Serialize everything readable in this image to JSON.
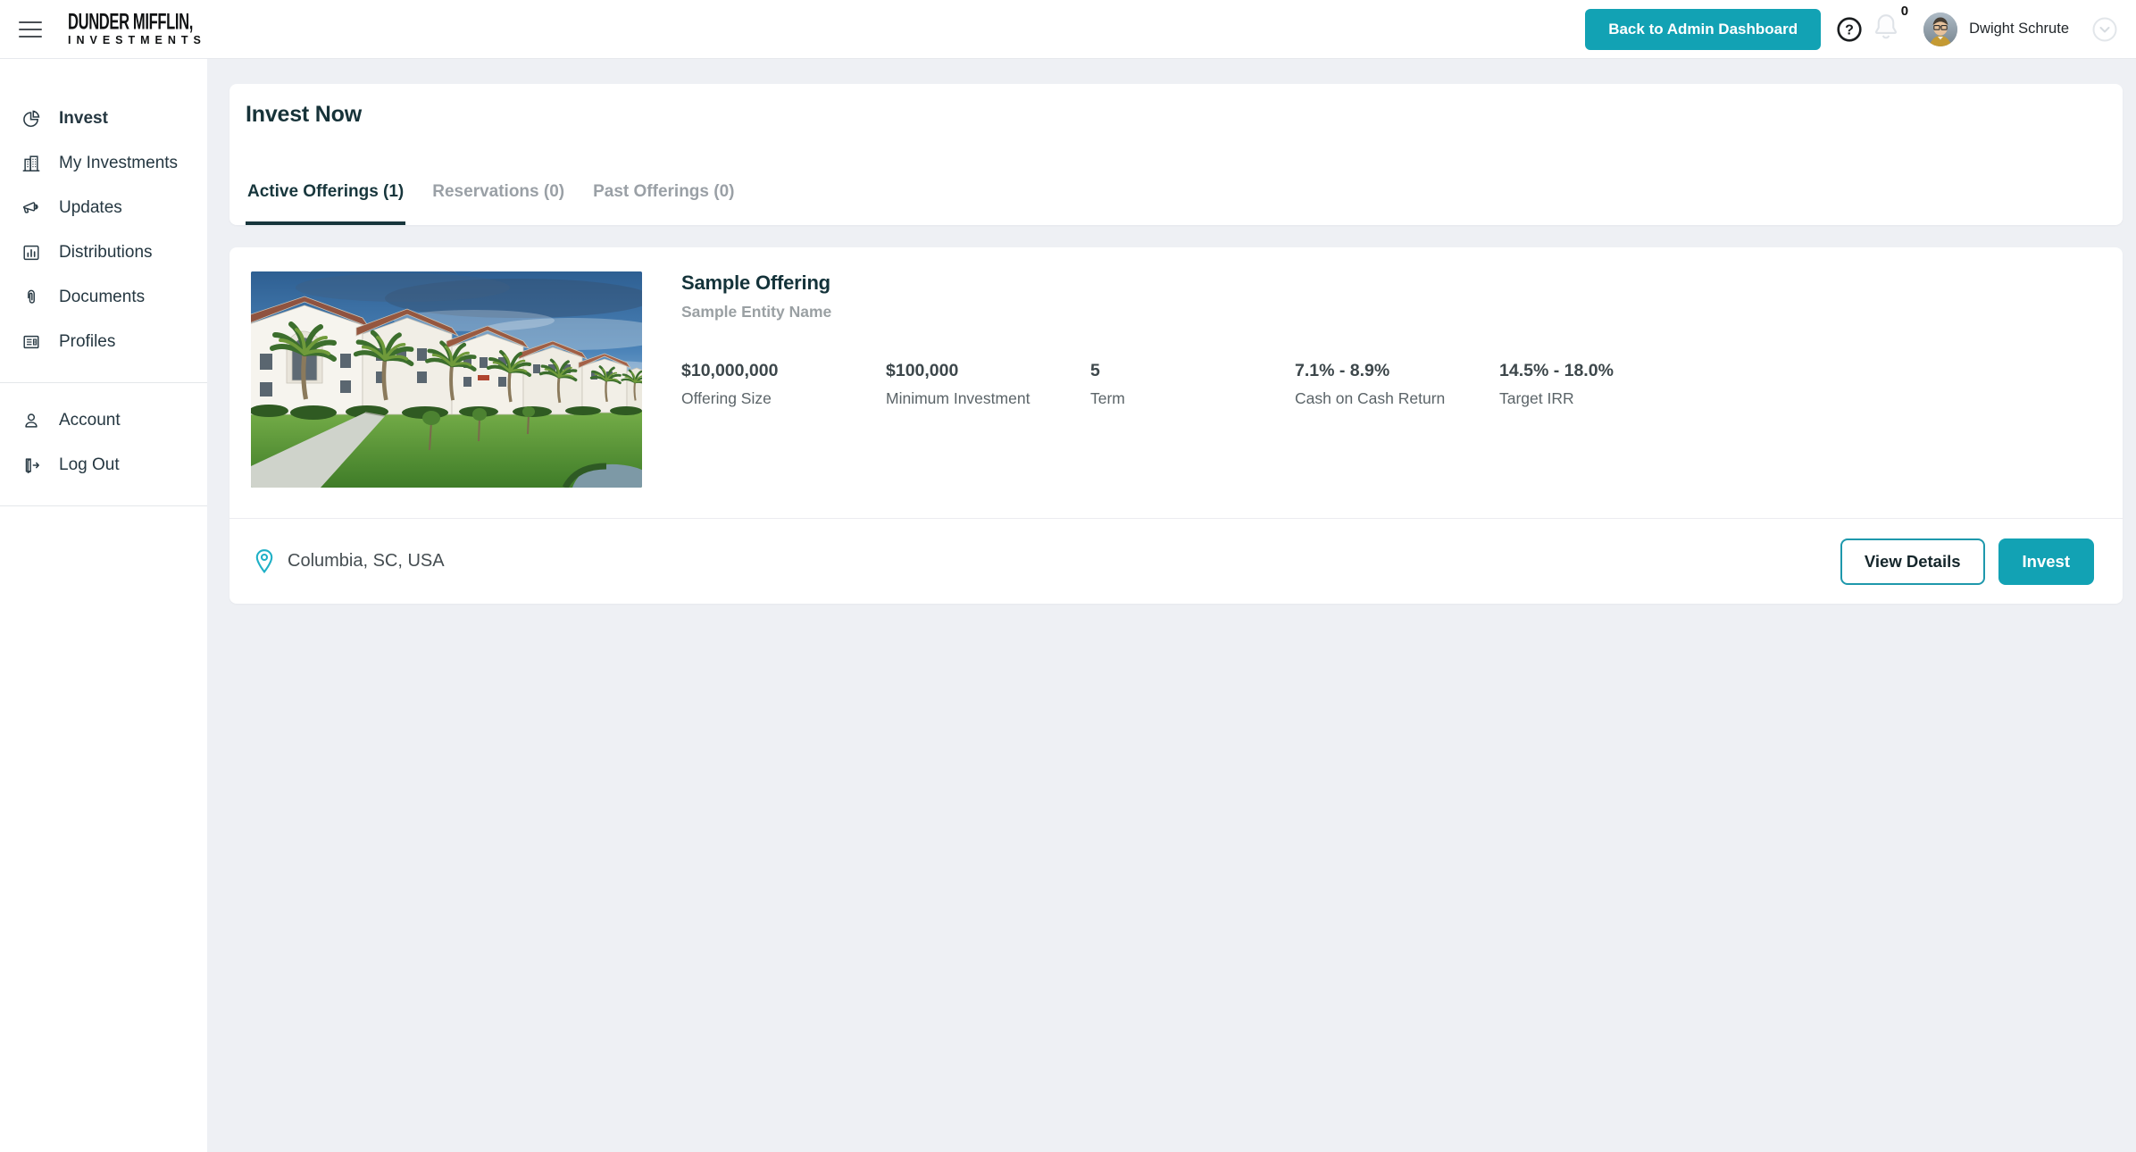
{
  "topbar": {
    "logo_line1": "DUNDER MIFFLIN,",
    "logo_line2": "INVESTMENTS",
    "back_button_label": "Back to Admin Dashboard",
    "notification_count": "0",
    "user_name": "Dwight Schrute"
  },
  "sidebar": {
    "items": [
      {
        "label": "Invest",
        "icon": "pie-chart-icon",
        "active": true
      },
      {
        "label": "My Investments",
        "icon": "building-icon",
        "active": false
      },
      {
        "label": "Updates",
        "icon": "megaphone-icon",
        "active": false
      },
      {
        "label": "Distributions",
        "icon": "bar-chart-icon",
        "active": false
      },
      {
        "label": "Documents",
        "icon": "paperclip-icon",
        "active": false
      },
      {
        "label": "Profiles",
        "icon": "id-card-icon",
        "active": false
      }
    ],
    "footer_items": [
      {
        "label": "Account",
        "icon": "user-icon"
      },
      {
        "label": "Log Out",
        "icon": "logout-icon"
      }
    ]
  },
  "main": {
    "title": "Invest Now",
    "tabs": [
      {
        "label": "Active Offerings (1)",
        "active": true
      },
      {
        "label": "Reservations (0)",
        "active": false
      },
      {
        "label": "Past Offerings (0)",
        "active": false
      }
    ]
  },
  "offering": {
    "title": "Sample Offering",
    "entity_name": "Sample Entity Name",
    "stats": [
      {
        "value": "$10,000,000",
        "label": "Offering Size"
      },
      {
        "value": "$100,000",
        "label": "Minimum Investment"
      },
      {
        "value": "5",
        "label": "Term"
      },
      {
        "value": "7.1% - 8.9%",
        "label": "Cash on Cash Return"
      },
      {
        "value": "14.5% - 18.0%",
        "label": "Target IRR"
      }
    ],
    "location": "Columbia, SC, USA",
    "view_details_label": "View Details",
    "invest_label": "Invest",
    "image_alt": "apartment-complex-photo"
  },
  "icons": {
    "hamburger": "three horizontal lines",
    "help": "question mark in circle",
    "bell": "notification bell outline",
    "chevron-down": "down chevron in circle",
    "pie-chart": "pie with slice",
    "building": "two office towers",
    "megaphone": "announcement megaphone",
    "bar-chart": "bar chart in square",
    "paperclip": "paperclip",
    "id-card": "document with lines",
    "user": "person silhouette",
    "logout": "door with arrow",
    "location-pin": "map pin"
  },
  "colors": {
    "accent_teal": "#12a2b4",
    "accent_teal_border": "#1e98ac",
    "pin_teal": "#1fb0c6",
    "heading_dark_teal": "#173339",
    "tab_inactive_gray": "#9aa0a6",
    "page_background": "#eef0f4",
    "surface_white": "#ffffff"
  }
}
